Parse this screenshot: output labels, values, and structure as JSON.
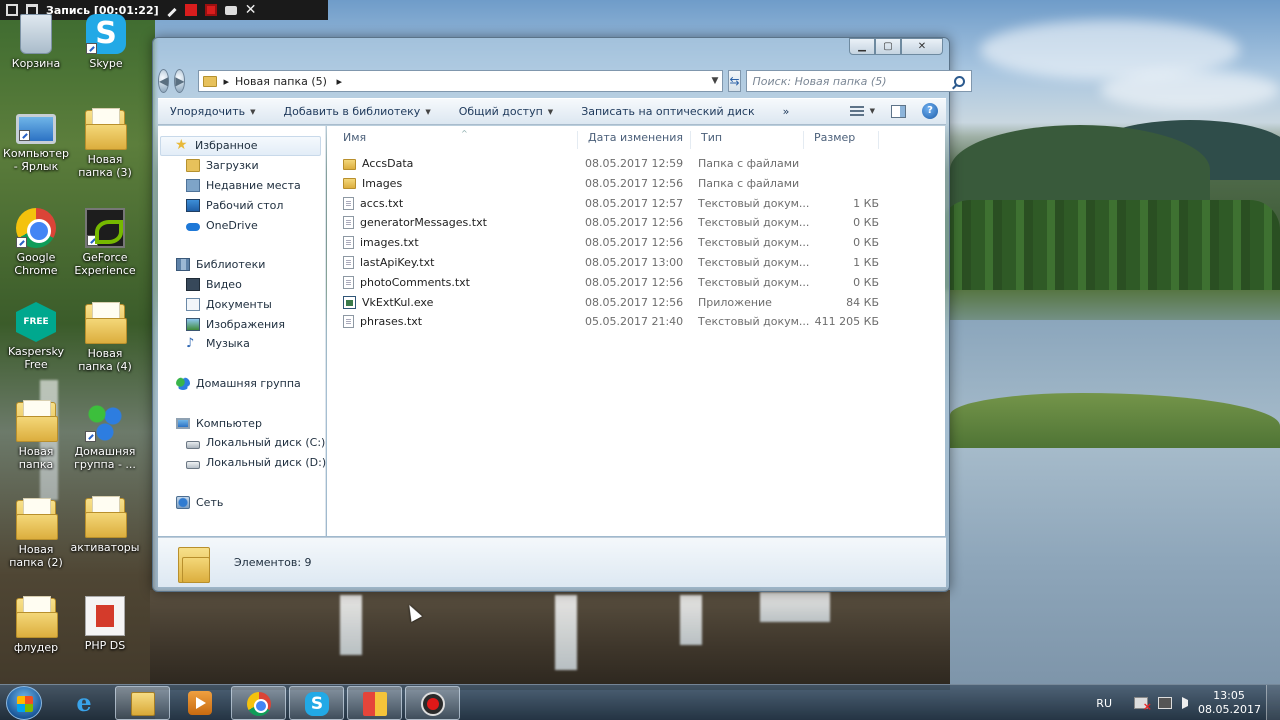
{
  "recorder": {
    "title": "Запись [00:01:22]"
  },
  "desktop_icons": [
    {
      "label": "Корзина"
    },
    {
      "label": "Skype"
    },
    {
      "label": "Компьютер - Ярлык"
    },
    {
      "label": "Новая папка (3)"
    },
    {
      "label": "Google Chrome"
    },
    {
      "label": "GeForce Experience"
    },
    {
      "label": "Kaspersky Free",
      "badge": "FREE"
    },
    {
      "label": "Новая папка (4)"
    },
    {
      "label": "Новая папка"
    },
    {
      "label": "Домашняя группа - ..."
    },
    {
      "label": "Новая папка (2)"
    },
    {
      "label": "активаторы"
    },
    {
      "label": "флудер"
    },
    {
      "label": "PHP DS"
    }
  ],
  "window": {
    "controls": {
      "minimize": "▁",
      "maximize": "▢",
      "close": "✕"
    },
    "address": {
      "path": "Новая папка (5)",
      "separator": "▸"
    },
    "search": {
      "placeholder": "Поиск: Новая папка (5)"
    },
    "toolbar": [
      {
        "label": "Упорядочить",
        "arrow": "▼"
      },
      {
        "label": "Добавить в библиотеку",
        "arrow": "▼"
      },
      {
        "label": "Общий доступ",
        "arrow": "▼"
      },
      {
        "label": "Записать на оптический диск",
        "arrow": ""
      },
      {
        "label": "»",
        "arrow": ""
      }
    ],
    "help": "?",
    "nav": {
      "favorites": {
        "label": "Избранное",
        "items": [
          "Загрузки",
          "Недавние места",
          "Рабочий стол",
          "OneDrive"
        ]
      },
      "libraries": {
        "label": "Библиотеки",
        "items": [
          "Видео",
          "Документы",
          "Изображения",
          "Музыка"
        ]
      },
      "homegroup": {
        "label": "Домашняя группа"
      },
      "computer": {
        "label": "Компьютер",
        "items": [
          "Локальный диск (C:)",
          "Локальный диск (D:)"
        ]
      },
      "network": {
        "label": "Сеть"
      }
    },
    "columns": {
      "name": "Имя",
      "date": "Дата изменения",
      "type": "Тип",
      "size": "Размер"
    },
    "files": [
      {
        "name": "AccsData",
        "date": "08.05.2017 12:59",
        "type": "Папка с файлами",
        "size": "",
        "icon": "folder"
      },
      {
        "name": "Images",
        "date": "08.05.2017 12:56",
        "type": "Папка с файлами",
        "size": "",
        "icon": "folder"
      },
      {
        "name": "accs.txt",
        "date": "08.05.2017 12:57",
        "type": "Текстовый докум...",
        "size": "1 КБ",
        "icon": "txt"
      },
      {
        "name": "generatorMessages.txt",
        "date": "08.05.2017 12:56",
        "type": "Текстовый докум...",
        "size": "0 КБ",
        "icon": "txt"
      },
      {
        "name": "images.txt",
        "date": "08.05.2017 12:56",
        "type": "Текстовый докум...",
        "size": "0 КБ",
        "icon": "txt"
      },
      {
        "name": "lastApiKey.txt",
        "date": "08.05.2017 13:00",
        "type": "Текстовый докум...",
        "size": "1 КБ",
        "icon": "txt"
      },
      {
        "name": "photoComments.txt",
        "date": "08.05.2017 12:56",
        "type": "Текстовый докум...",
        "size": "0 КБ",
        "icon": "txt"
      },
      {
        "name": "VkExtKul.exe",
        "date": "08.05.2017 12:56",
        "type": "Приложение",
        "size": "84 КБ",
        "icon": "exe"
      },
      {
        "name": "phrases.txt",
        "date": "05.05.2017 21:40",
        "type": "Текстовый докум...",
        "size": "411 205 КБ",
        "icon": "txt"
      }
    ],
    "status": {
      "text": "Элементов: 9"
    }
  },
  "taskbar": {
    "apps": [
      {
        "name": "Internet Explorer",
        "glyph": "e"
      },
      {
        "name": "Проводник"
      },
      {
        "name": "Media Player"
      },
      {
        "name": "Google Chrome"
      },
      {
        "name": "Skype",
        "glyph": "S"
      },
      {
        "name": "Windows App"
      },
      {
        "name": "Recorder"
      }
    ],
    "language": "RU",
    "time": "13:05",
    "date": "08.05.2017"
  }
}
